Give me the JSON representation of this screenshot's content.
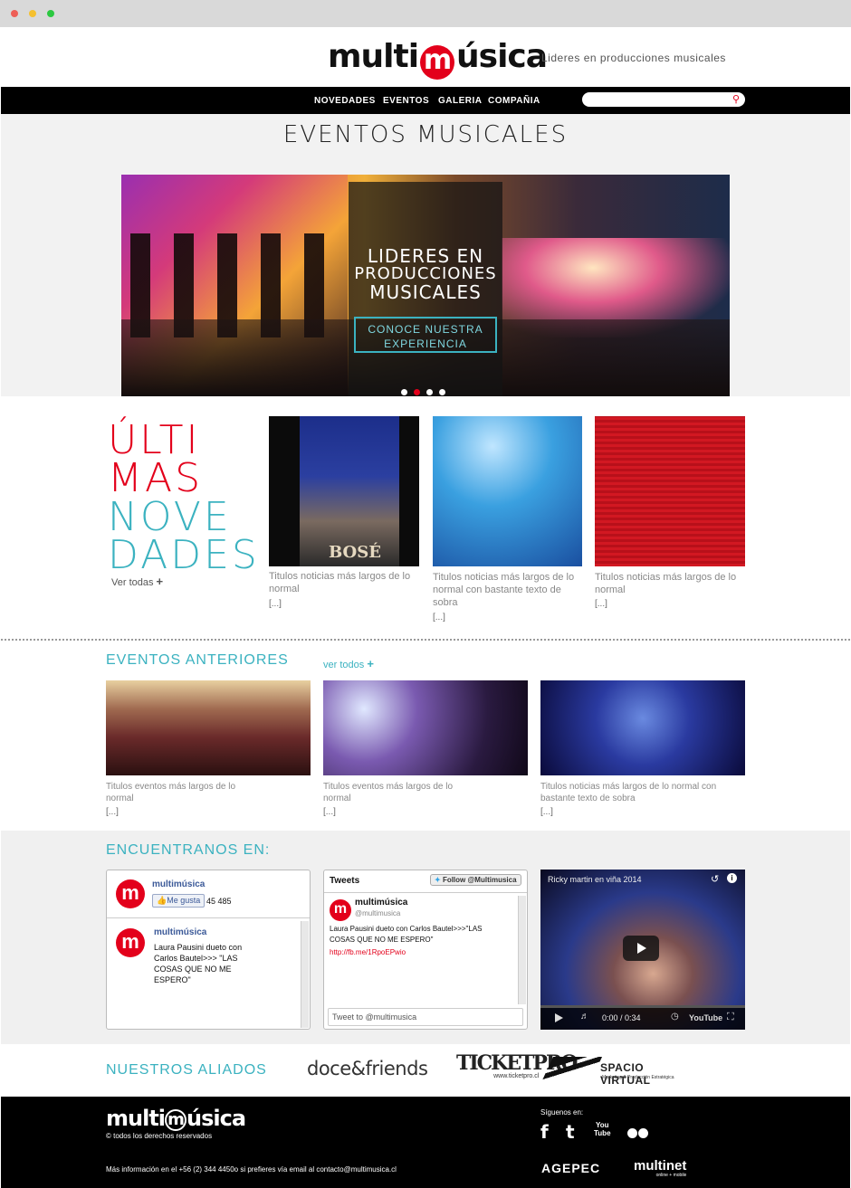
{
  "header": {
    "logo_left": "multi",
    "logo_m": "m",
    "logo_right": "úsica",
    "tagline": "Lideres en producciones musicales"
  },
  "nav": {
    "items": [
      "NOVEDADES",
      "EVENTOS",
      "GALERIA",
      "COMPAÑIA"
    ],
    "search_placeholder": ""
  },
  "hero": {
    "title": "EVENTOS MUSICALES",
    "banner_line1": "LIDERES EN",
    "banner_line2": "PRODUCCIONES",
    "banner_line3": "MUSICALES",
    "cta": "CONOCE NUESTRA EXPERIENCIA",
    "active_slide": 2,
    "slide_count": 4
  },
  "news": {
    "heading1a": "ÚLTI",
    "heading1b": "MAS",
    "heading2a": "NOVE",
    "heading2b": "DADES",
    "see_all": "Ver todas",
    "items": [
      {
        "caption": "Titulos  noticias más largos de lo normal",
        "more": "[...]",
        "badge": "BOSÉ"
      },
      {
        "caption": "Titulos  noticias más largos de lo normal con bastante texto de sobra",
        "more": "[...]"
      },
      {
        "caption": "Titulos  noticias más largos de lo normal",
        "more": "[...]"
      }
    ]
  },
  "past_events": {
    "title": "EVENTOS ANTERIORES",
    "see_all": "ver todos",
    "items": [
      {
        "caption": "Titulos  eventos más largos de lo normal",
        "more": "[...]"
      },
      {
        "caption": "Titulos  eventos más largos de lo normal",
        "more": "[...]"
      },
      {
        "caption": "Titulos  noticias más largos de lo normal con bastante texto de sobra",
        "more": "[...]"
      }
    ]
  },
  "find_us": {
    "title": "ENCUENTRANOS EN:",
    "facebook": {
      "page_name": "multimúsica",
      "like_label": "Me gusta",
      "like_count": "45 485",
      "post_author": "multimúsica",
      "post_text": "Laura Pausini dueto con Carlos Bautel>>> \"LAS COSAS QUE NO ME ESPERO\""
    },
    "twitter": {
      "header": "Tweets",
      "follow_label": "Follow @Multimusica",
      "author": "multimúsica",
      "handle": "@multimusica",
      "text": "Laura Pausini dueto con Carlos Bautel>>>\"LAS COSAS QUE NO ME ESPERO\"",
      "link": "http://fb.me/1RpoEPwio",
      "compose_placeholder": "Tweet to @multimusica"
    },
    "video": {
      "title": "Ricky martin en viña 2014",
      "time": "0:00 / 0:34",
      "brand": "YouTube"
    }
  },
  "allies": {
    "title": "NUESTROS ALIADOS",
    "partners": [
      "doce&friends",
      "TICKETPRO",
      "www.ticketpro.cl",
      "SPACIO VIRTUAL",
      "Marketing & Producción Estratégica"
    ]
  },
  "footer": {
    "logo_left": "multi",
    "logo_m": "m",
    "logo_right": "úsica",
    "rights": "© todos los derechos reservados",
    "follow_label": "Síguenos en:",
    "contact": "Más información en el +56 (2) 344 4450o si prefieres vía email al contacto@multimusica.cl",
    "partner1": "AGEPEC",
    "partner2": "multinet",
    "partner2_sub": "online + mobile",
    "social": [
      "facebook-icon",
      "twitter-icon",
      "youtube-icon",
      "flickr-icon"
    ]
  },
  "colors": {
    "accent_red": "#e3001b",
    "accent_teal": "#3bb2c0"
  }
}
